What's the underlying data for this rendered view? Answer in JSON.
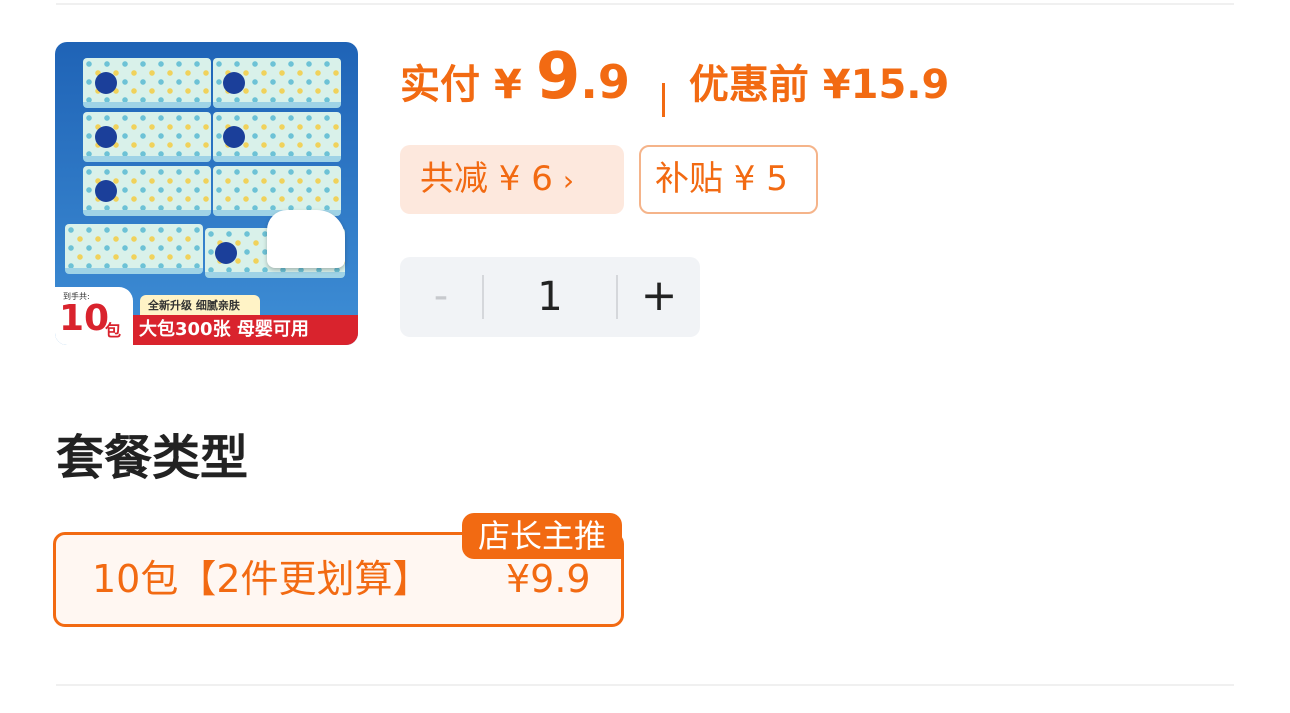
{
  "product": {
    "image_alt": "product-thumbnail",
    "image_text": {
      "small_label": "到手共:",
      "count": "10",
      "count_unit": "包",
      "promo_top": "全新升级 细腻亲肤",
      "promo_bottom": "大包300张 母婴可用"
    }
  },
  "price": {
    "paid_label": "实付",
    "currency": "¥",
    "paid_int": "9",
    "paid_dec": ".9",
    "before_label": "优惠前 ¥15.9"
  },
  "discounts": {
    "total_label": "共减 ¥ 6",
    "total_chevron": "›",
    "subsidy_label": "补贴 ¥ 5"
  },
  "quantity": {
    "minus": "-",
    "value": "1",
    "plus": "+"
  },
  "package": {
    "title": "套餐类型",
    "options": [
      {
        "name": "10包【2件更划算】",
        "price": "¥9.9",
        "badge": "店长主推",
        "selected": true
      }
    ]
  },
  "colors": {
    "accent": "#f26a12",
    "tag_bg": "#fde8dd",
    "stepper_bg": "#f1f3f6",
    "promo_red": "#d9232d"
  }
}
